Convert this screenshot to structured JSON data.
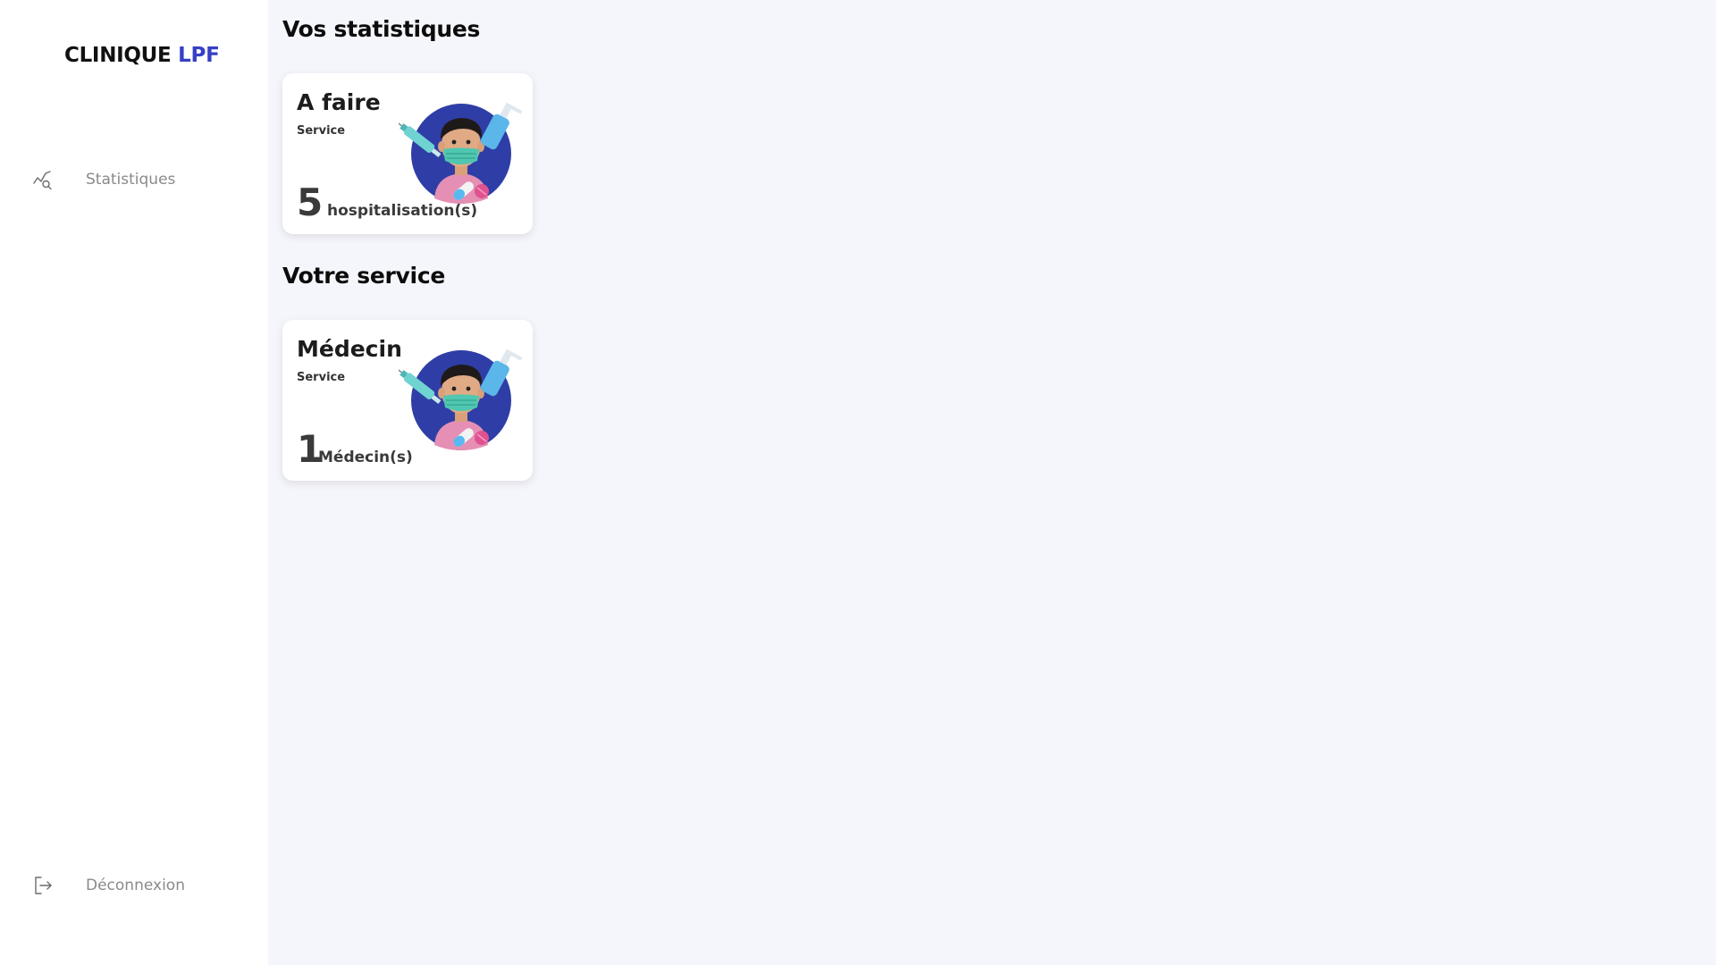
{
  "sidebar": {
    "brand_main": "CLINIQUE",
    "brand_accent": "LPF",
    "items": [
      {
        "label": "Statistiques",
        "icon": "chart-search-icon"
      }
    ],
    "logout": {
      "label": "Déconnexion",
      "icon": "logout-icon"
    }
  },
  "main": {
    "stats_title": "Vos statistiques",
    "service_title": "Votre service",
    "cards": [
      {
        "title": "A faire",
        "subtitle": "Service",
        "count": "5",
        "unit": "hospitalisation(s)",
        "illustration": "doctor-illustration"
      },
      {
        "title": "Médecin",
        "subtitle": "Service",
        "count": "1",
        "unit": "Médecin(s)",
        "illustration": "doctor-illustration"
      }
    ]
  },
  "colors": {
    "accent": "#3540c4",
    "background": "#f5f6fc",
    "sidebar": "#ffffff",
    "illustration_circle": "#2f3ea6"
  }
}
